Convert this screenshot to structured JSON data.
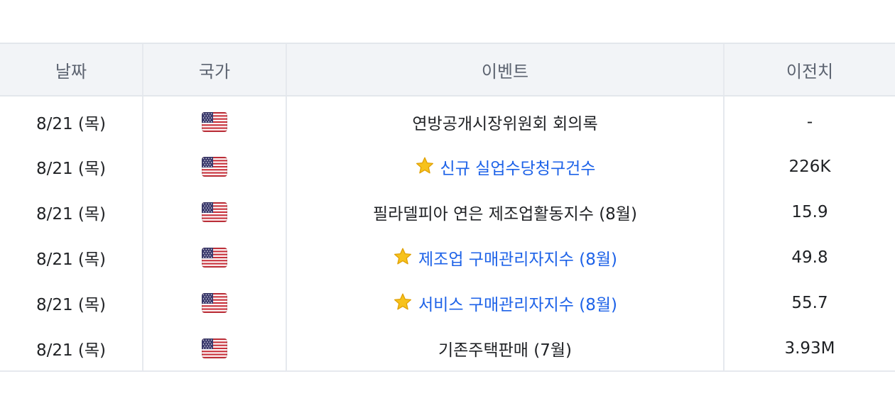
{
  "table": {
    "headers": {
      "date": "날짜",
      "country": "국가",
      "event": "이벤트",
      "previous": "이전치"
    },
    "rows": [
      {
        "date": "8/21 (목)",
        "country_icon": "us-flag-icon",
        "event": "연방공개시장위원회 회의록",
        "important": false,
        "previous": "-"
      },
      {
        "date": "8/21 (목)",
        "country_icon": "us-flag-icon",
        "event": "신규 실업수당청구건수",
        "important": true,
        "previous": "226K"
      },
      {
        "date": "8/21 (목)",
        "country_icon": "us-flag-icon",
        "event": "필라델피아 연은 제조업활동지수 (8월)",
        "important": false,
        "previous": "15.9"
      },
      {
        "date": "8/21 (목)",
        "country_icon": "us-flag-icon",
        "event": "제조업 구매관리자지수 (8월)",
        "important": true,
        "previous": "49.8"
      },
      {
        "date": "8/21 (목)",
        "country_icon": "us-flag-icon",
        "event": "서비스 구매관리자지수 (8월)",
        "important": true,
        "previous": "55.7"
      },
      {
        "date": "8/21 (목)",
        "country_icon": "us-flag-icon",
        "event": "기존주택판매 (7월)",
        "important": false,
        "previous": "3.93M"
      }
    ]
  },
  "colors": {
    "header_bg": "#f2f4f7",
    "header_text": "#5c6370",
    "important_text": "#1d62e8",
    "body_text": "#1f2124",
    "star": "#f7c21b"
  }
}
